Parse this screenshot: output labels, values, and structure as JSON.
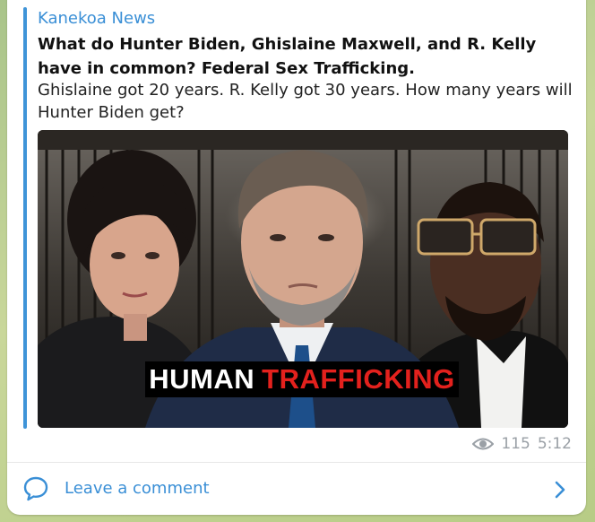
{
  "post": {
    "channel": "Kanekoa News",
    "headline": "What do Hunter Biden, Ghislaine Maxwell, and R. Kelly have in common? Federal Sex Trafficking.",
    "body": "Ghislaine got 20 years. R. Kelly got 30 years. How many years will Hunter Biden get?",
    "image_banner_white": "HUMAN",
    "image_banner_red": "TRAFFICKING",
    "views": "115",
    "time": "5:12"
  },
  "footer": {
    "comment_label": "Leave a comment"
  },
  "colors": {
    "accent": "#3a8fd6",
    "banner_red": "#e3211d",
    "meta_gray": "#9aa0a6"
  },
  "icons": {
    "views": "eye-icon",
    "comment": "comment-bubble-icon",
    "go": "chevron-right-icon"
  }
}
